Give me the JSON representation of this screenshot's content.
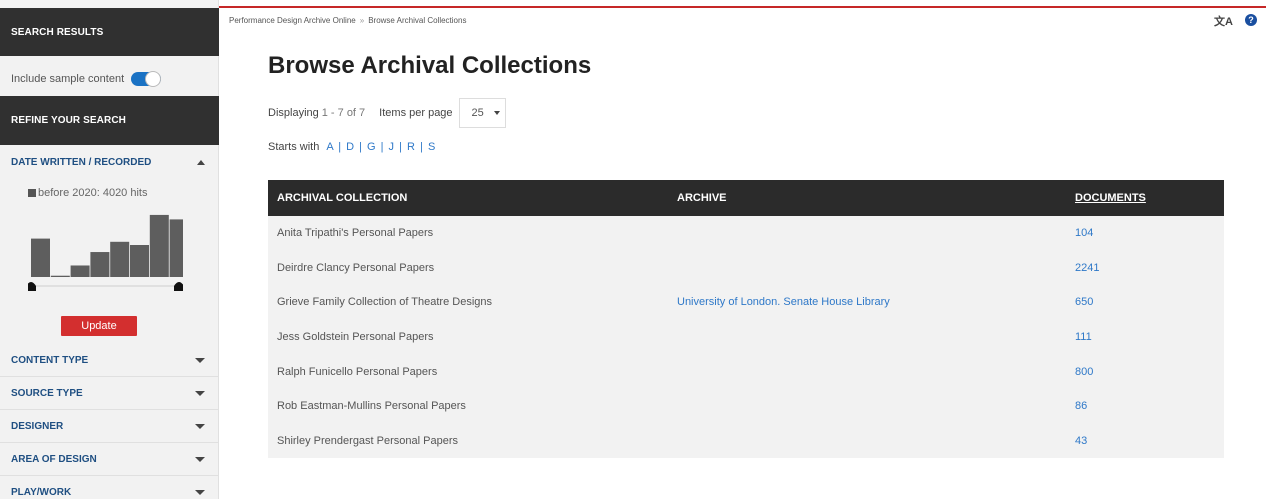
{
  "sidebar": {
    "search_results_title": "SEARCH RESULTS",
    "include_sample_label": "Include sample content",
    "include_sample_on": true,
    "refine_title": "REFINE YOUR SEARCH",
    "date_facet": {
      "label": "DATE WRITTEN / RECORDED",
      "hist_label": "before 2020: 4020 hits",
      "bars": [
        0.6,
        0.02,
        0.18,
        0.39,
        0.55,
        0.5,
        0.97,
        0.9
      ],
      "update_label": "Update"
    },
    "facets": [
      {
        "label": "CONTENT TYPE"
      },
      {
        "label": "SOURCE TYPE"
      },
      {
        "label": "DESIGNER"
      },
      {
        "label": "AREA OF DESIGN"
      },
      {
        "label": "PLAY/WORK"
      }
    ]
  },
  "header": {
    "breadcrumb": [
      "Performance Design Archive Online",
      "Browse Archival Collections"
    ],
    "breadcrumb_separator": "»",
    "translate_glyph": "文A",
    "help_glyph": "?"
  },
  "main": {
    "title": "Browse Archival Collections",
    "displaying_label": "Displaying",
    "displaying_range": "1 - 7 of 7",
    "items_per_page_label": "Items per page",
    "items_per_page_value": "25",
    "starts_with_label": "Starts with",
    "starts_with_letters": "A | D | G | J | R | S"
  },
  "table": {
    "columns": [
      "ARCHIVAL COLLECTION",
      "ARCHIVE",
      "DOCUMENTS"
    ],
    "rows": [
      {
        "collection": "Anita Tripathi's Personal Papers",
        "archive": "",
        "documents": "104"
      },
      {
        "collection": "Deirdre Clancy Personal Papers",
        "archive": "",
        "documents": "2241"
      },
      {
        "collection": "Grieve Family Collection of Theatre Designs",
        "archive": "University of London. Senate House Library",
        "documents": "650"
      },
      {
        "collection": "Jess Goldstein Personal Papers",
        "archive": "",
        "documents": "111"
      },
      {
        "collection": "Ralph Funicello Personal Papers",
        "archive": "",
        "documents": "800"
      },
      {
        "collection": "Rob Eastman-Mullins Personal Papers",
        "archive": "",
        "documents": "86"
      },
      {
        "collection": "Shirley Prendergast Personal Papers",
        "archive": "",
        "documents": "43"
      }
    ]
  },
  "colors": {
    "accent_red": "#d32f2f",
    "link_blue": "#2e78c8",
    "dark_header": "#2b2b2b"
  }
}
